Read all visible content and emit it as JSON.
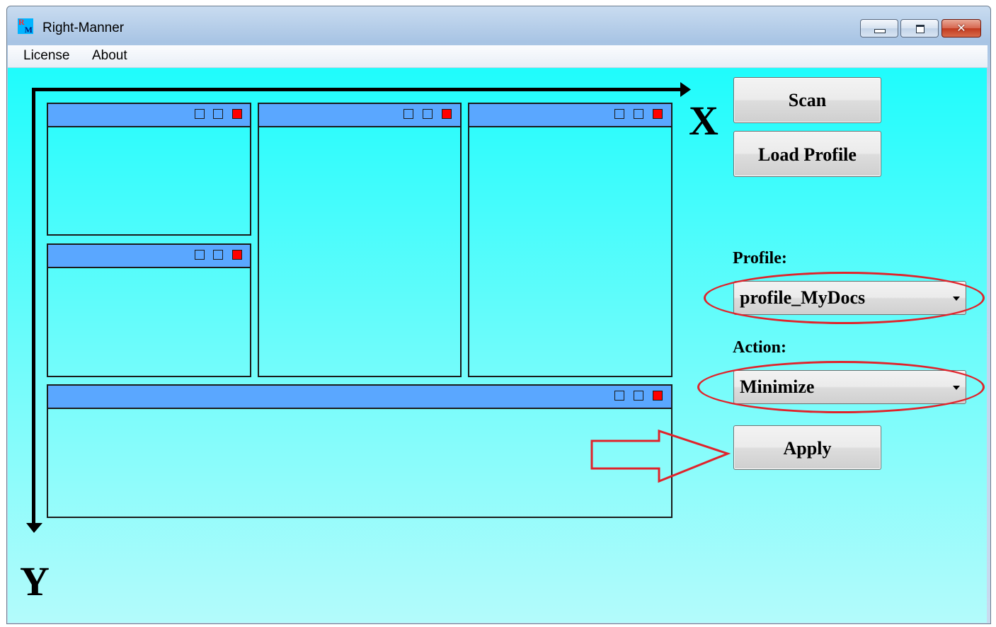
{
  "window": {
    "title": "Right-Manner",
    "icon": "right-manner-logo",
    "icon_letters": [
      "R",
      "M"
    ],
    "controls": [
      "minimize",
      "maximize",
      "close"
    ]
  },
  "menu": {
    "items": [
      {
        "label": "License"
      },
      {
        "label": "About"
      }
    ]
  },
  "diagram": {
    "x_label": "X",
    "y_label": "Y",
    "pane_header_color": "#5aa7ff",
    "close_square_color": "#ff0000"
  },
  "controls": {
    "scan_label": "Scan",
    "load_profile_label": "Load Profile",
    "profile_label": "Profile:",
    "profile_value": "profile_MyDocs",
    "action_label": "Action:",
    "action_value": "Minimize",
    "apply_label": "Apply"
  },
  "annotations": {
    "highlight_color": "#e0232b"
  }
}
